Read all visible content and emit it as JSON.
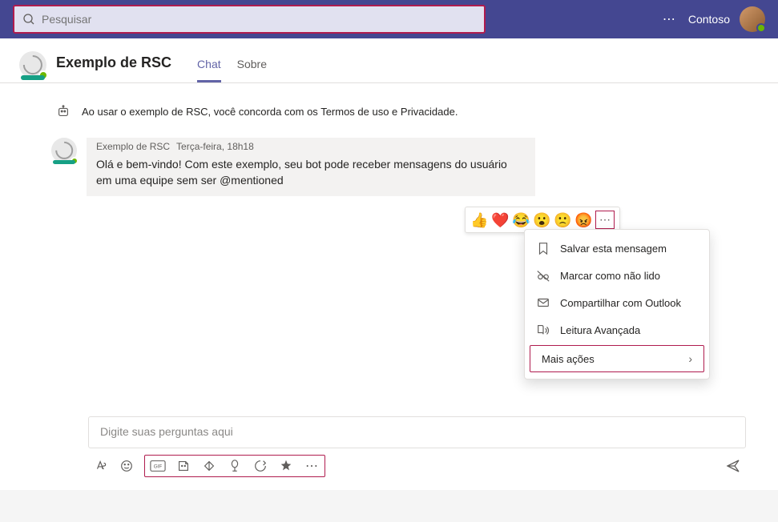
{
  "top": {
    "search_placeholder": "Pesquisar",
    "org": "Contoso"
  },
  "header": {
    "title": "Exemplo de RSC",
    "tabs": {
      "chat": "Chat",
      "about": "Sobre"
    }
  },
  "notice": "Ao usar o exemplo de RSC, você concorda com os Termos de uso e Privacidade.",
  "message": {
    "author": "Exemplo de RSC",
    "timestamp": "Terça-feira, 18h18",
    "body": "Olá e bem-vindo! Com este exemplo, seu bot pode receber mensagens do usuário em uma equipe sem ser @mentioned"
  },
  "reactions": {
    "like": "👍",
    "heart": "❤️",
    "laugh": "😂",
    "surprised": "😮",
    "sad": "🙁",
    "angry": "😡"
  },
  "menu": {
    "save": "Salvar esta mensagem",
    "unread": "Marcar como não lido",
    "share": "Compartilhar com Outlook",
    "immersive": "Leitura Avançada",
    "more": "Mais ações"
  },
  "compose": {
    "placeholder": "Digite suas perguntas aqui"
  }
}
